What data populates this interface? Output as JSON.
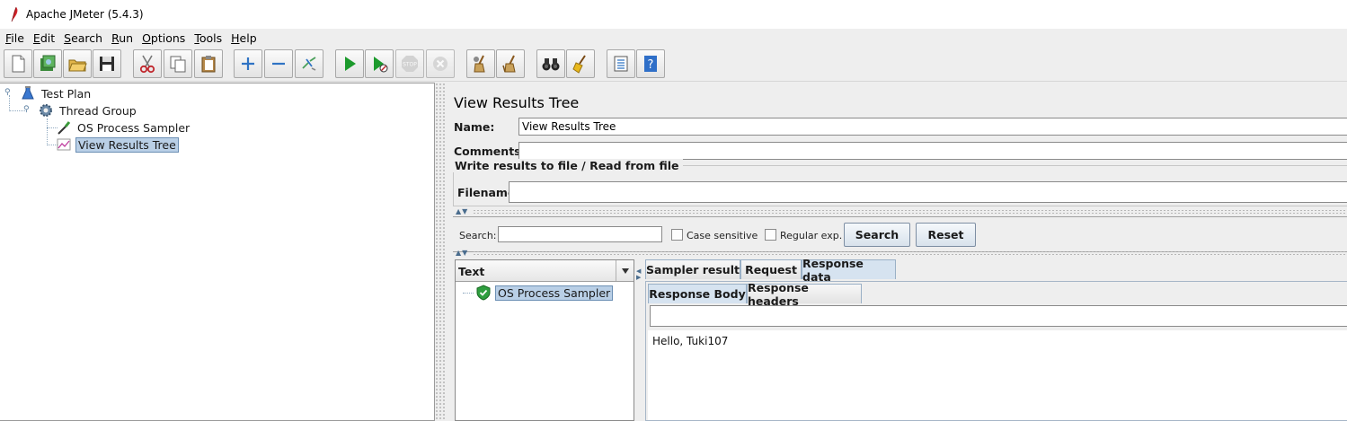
{
  "window": {
    "title": "Apache JMeter (5.4.3)"
  },
  "menu": [
    {
      "label": "File",
      "mnemonic": "F",
      "rest": "ile"
    },
    {
      "label": "Edit",
      "mnemonic": "E",
      "rest": "dit"
    },
    {
      "label": "Search",
      "mnemonic": "S",
      "rest": "earch"
    },
    {
      "label": "Run",
      "mnemonic": "R",
      "rest": "un"
    },
    {
      "label": "Options",
      "mnemonic": "O",
      "rest": "ptions"
    },
    {
      "label": "Tools",
      "mnemonic": "T",
      "rest": "ools"
    },
    {
      "label": "Help",
      "mnemonic": "H",
      "rest": "elp"
    }
  ],
  "toolbar": {
    "buttons": [
      "new-icon",
      "templates-icon",
      "open-icon",
      "save-icon",
      "cut-icon",
      "copy-icon",
      "paste-icon",
      "expand-icon",
      "collapse-icon",
      "toggle-icon",
      "start-icon",
      "start-no-pauses-icon",
      "stop-icon",
      "shutdown-icon",
      "clear-icon",
      "clear-all-icon",
      "search-icon",
      "reset-search-icon",
      "function-helper-icon",
      "help-icon"
    ]
  },
  "tree": {
    "test_plan": "Test Plan",
    "thread_group": "Thread Group",
    "sampler": "OS Process Sampler",
    "listener": "View Results Tree"
  },
  "panel": {
    "title": "View Results Tree",
    "name_label": "Name:",
    "name_value": "View Results Tree",
    "comments_label": "Comments:",
    "comments_value": "",
    "file_legend": "Write results to file / Read from file",
    "filename_label": "Filename",
    "filename_value": ""
  },
  "search": {
    "label": "Search:",
    "value": "",
    "case_sensitive_label": "Case sensitive",
    "case_sensitive_checked": false,
    "regex_label": "Regular exp.",
    "regex_checked": false,
    "search_button": "Search",
    "reset_button": "Reset"
  },
  "results": {
    "column_header": "Text",
    "items": [
      {
        "label": "OS Process Sampler",
        "status": "success"
      }
    ],
    "tabs": [
      "Sampler result",
      "Request",
      "Response data"
    ],
    "active_tab": "Response data",
    "subtabs": [
      "Response Body",
      "Response headers"
    ],
    "active_subtab": "Response Body",
    "filter_value": "",
    "response_body": "Hello, Tuki107"
  },
  "colors": {
    "selection": "#b9cfe6",
    "success": "#2e9e3e",
    "start_green": "#1c9a2c"
  }
}
